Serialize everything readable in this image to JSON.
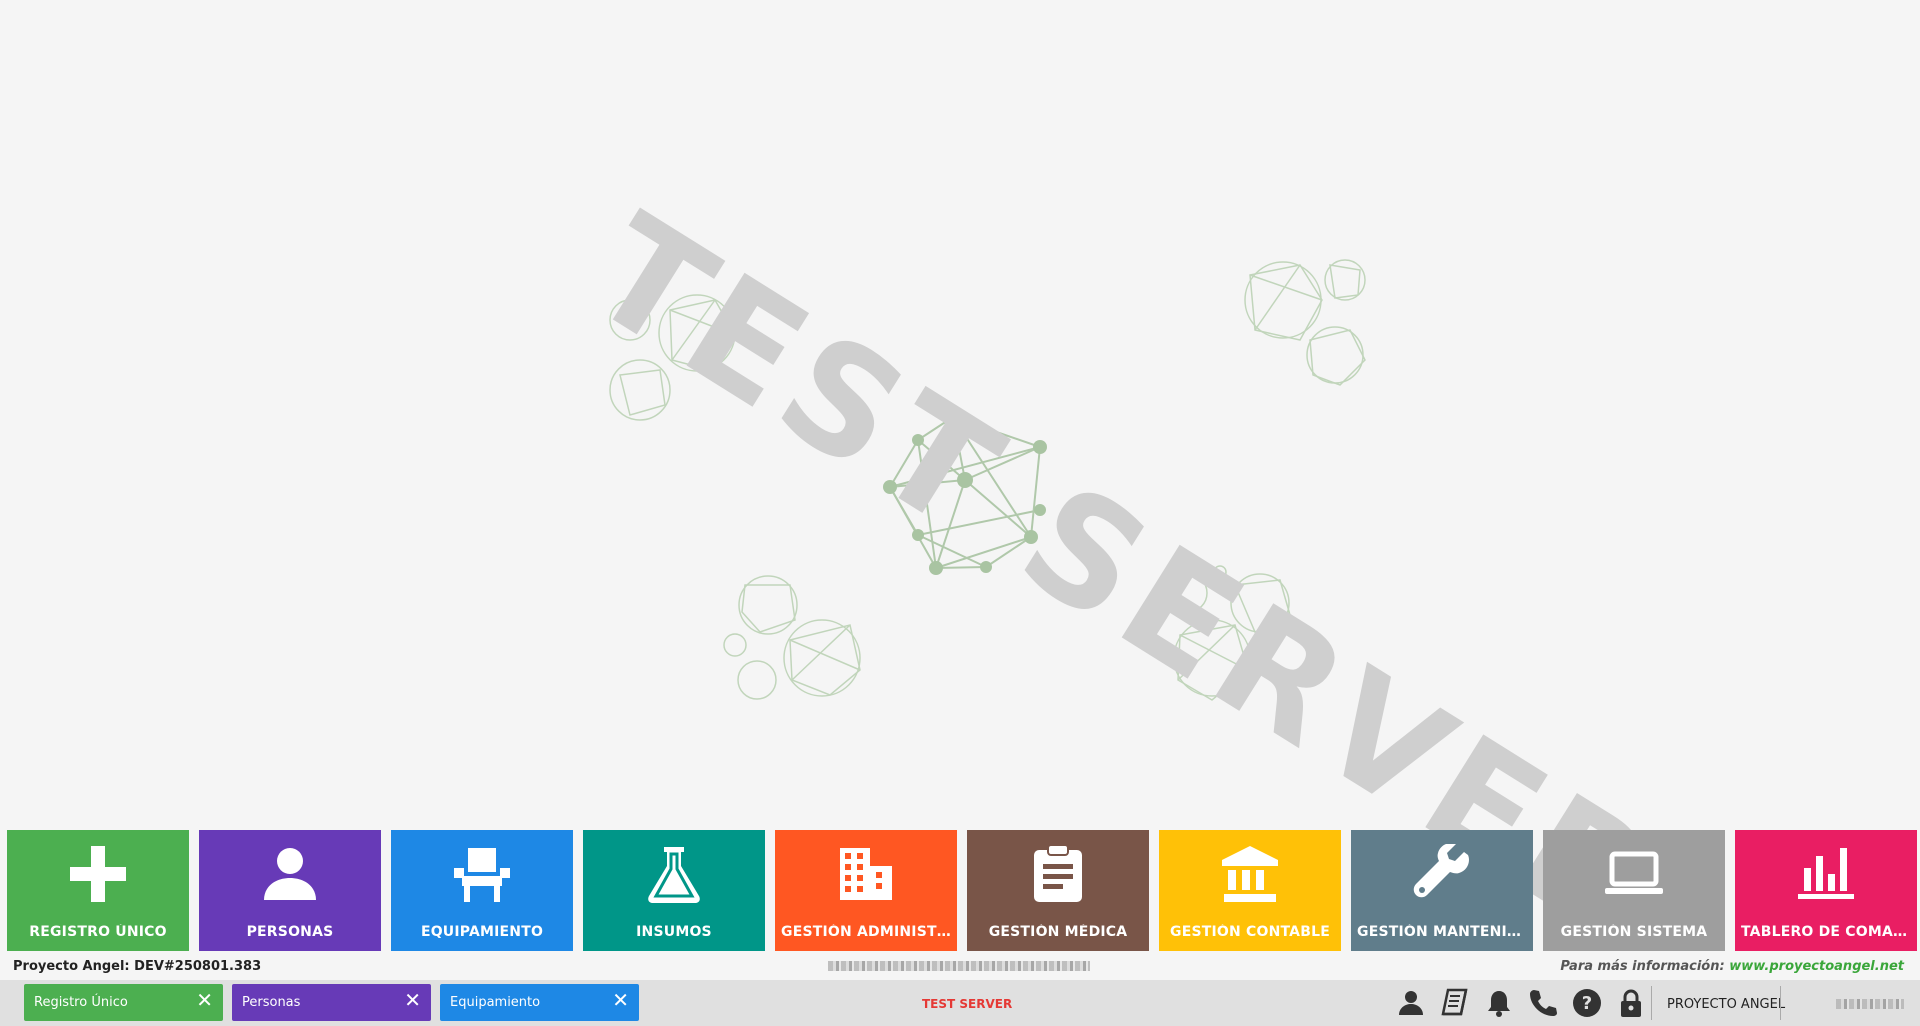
{
  "watermark": "TEST SERVER",
  "tiles": [
    {
      "label": "REGISTRO ÚNICO",
      "color": "#4caf50",
      "icon": "plus-icon"
    },
    {
      "label": "PERSONAS",
      "color": "#673ab7",
      "icon": "person-icon"
    },
    {
      "label": "EQUIPAMIENTO",
      "color": "#1e88e5",
      "icon": "chair-icon"
    },
    {
      "label": "INSUMOS",
      "color": "#009688",
      "icon": "flask-icon"
    },
    {
      "label": "GESTIÓN ADMINISTR...",
      "color": "#ff5722",
      "icon": "building-icon"
    },
    {
      "label": "GESTIÓN MÉDICA",
      "color": "#795548",
      "icon": "clipboard-icon"
    },
    {
      "label": "GESTIÓN CONTABLE",
      "color": "#ffc107",
      "icon": "bank-icon"
    },
    {
      "label": "GESTIÓN MANTENIMI...",
      "color": "#607d8b",
      "icon": "wrench-icon"
    },
    {
      "label": "GESTIÓN SISTEMA",
      "color": "#9e9e9e",
      "icon": "laptop-icon"
    },
    {
      "label": "TABLERO DE COMANDO",
      "color": "#e91e63",
      "icon": "bar-chart-icon"
    }
  ],
  "status": {
    "version": "Proyecto Angel: DEV#250801.383",
    "info_prefix": "Para más información:",
    "info_url": "www.proyectoangel.net"
  },
  "taskbar": {
    "tasks": [
      {
        "label": "Registro Único",
        "color": "#4caf50"
      },
      {
        "label": "Personas",
        "color": "#673ab7"
      },
      {
        "label": "Equipamiento",
        "color": "#1e88e5"
      }
    ],
    "close_glyph": "✕",
    "server_label": "TEST SERVER",
    "icons": [
      "user-icon",
      "book-icon",
      "bell-icon",
      "phone-icon",
      "help-icon",
      "lock-icon"
    ],
    "brand": "PROYECTO ANGEL"
  }
}
